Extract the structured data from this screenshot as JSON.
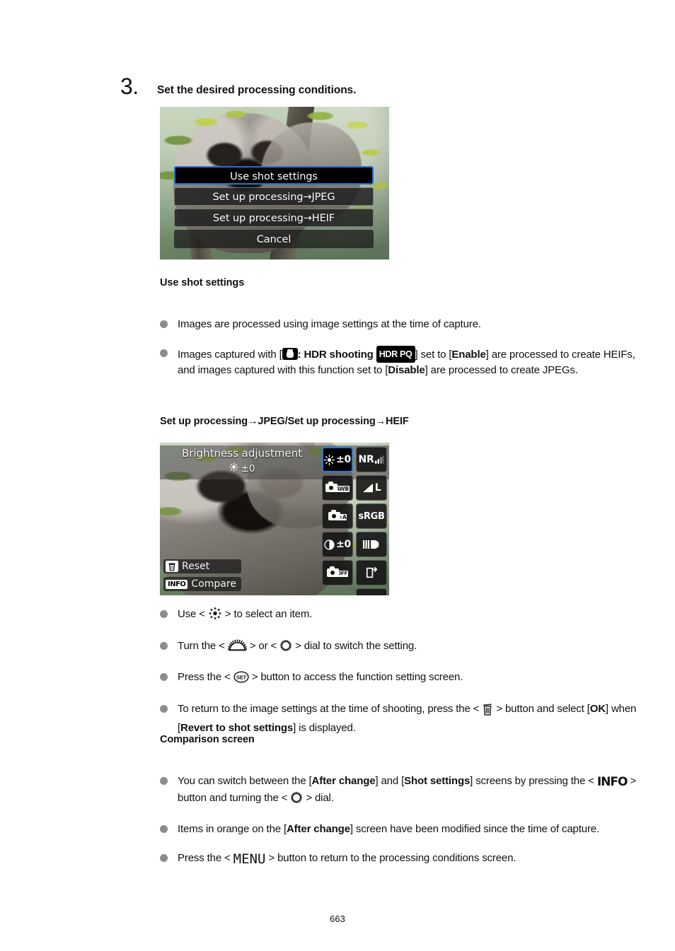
{
  "step": {
    "number": "3.",
    "title": "Set the desired processing conditions."
  },
  "screen1": {
    "name": "processing-conditions-menu",
    "items": [
      {
        "label": "Use shot settings",
        "selected": true
      },
      {
        "label": "Set up processing→JPEG",
        "selected": false
      },
      {
        "label": "Set up processing→HEIF",
        "selected": false
      },
      {
        "label": "Cancel",
        "selected": false
      }
    ],
    "highlight_color": "#1f6fe0"
  },
  "section_use_shot": {
    "heading": "Use shot settings",
    "bullets": [
      {
        "parts": [
          {
            "t": "text",
            "v": "Images are processed using image settings at the time of capture."
          }
        ]
      },
      {
        "parts": [
          {
            "t": "text",
            "v": "Images captured with ["
          },
          {
            "t": "icon",
            "v": "camera-icon"
          },
          {
            "t": "bold",
            "v": ": HDR shooting "
          },
          {
            "t": "badge",
            "v": "HDR PQ"
          },
          {
            "t": "text",
            "v": "] set to ["
          },
          {
            "t": "bold",
            "v": "Enable"
          },
          {
            "t": "text",
            "v": "] are processed to create HEIFs, and images captured with this function set to ["
          },
          {
            "t": "bold",
            "v": "Disable"
          },
          {
            "t": "text",
            "v": "] are processed to create JPEGs."
          }
        ]
      }
    ]
  },
  "section_setup": {
    "heading": "Set up processing→JPEG/Set up processing→HEIF"
  },
  "screen2": {
    "name": "quick-control-processing-screen",
    "title": "Brightness adjustment",
    "value": "±0",
    "value_icon": "brightness-sun-icon",
    "magnify_icon": "magnify-icon",
    "highlight_color": "#1f7ae0",
    "grid": [
      {
        "id": "brightness-adjustment",
        "label": "±0",
        "icon": "sun-icon",
        "selected": true
      },
      {
        "id": "noise-reduction",
        "label": "NR",
        "icon": "nr-bars-icon",
        "selected": false
      },
      {
        "id": "white-balance",
        "label": "AWB",
        "icon": "camera-awb-icon",
        "selected": false
      },
      {
        "id": "image-quality",
        "label": "L",
        "icon": "quality-fine-large-icon",
        "selected": false
      },
      {
        "id": "picture-style",
        "label": "A",
        "icon": "camera-picture-style-auto-icon",
        "selected": false
      },
      {
        "id": "color-space",
        "label": "sRGB",
        "icon": "srgb-icon",
        "selected": false
      },
      {
        "id": "contrast",
        "label": "±0",
        "icon": "contrast-icon",
        "selected": false
      },
      {
        "id": "lens-aberration-correction",
        "label": "",
        "icon": "lens-correction-icon",
        "selected": false
      },
      {
        "id": "dust-delete-data",
        "label": "OFF",
        "icon": "camera-off-icon",
        "selected": false
      },
      {
        "id": "save-image",
        "label": "",
        "icon": "save-icon",
        "selected": false
      },
      {
        "id": "blank",
        "label": "",
        "icon": "",
        "selected": false
      },
      {
        "id": "return",
        "label": "",
        "icon": "return-arrow-icon",
        "selected": false
      }
    ],
    "reset_label": "Reset",
    "reset_icon": "trash-icon",
    "compare_label": "Compare",
    "compare_icon": "info-chip-icon"
  },
  "section_setup_bullets": {
    "bullets": [
      {
        "parts": [
          {
            "t": "text",
            "v": "Use < "
          },
          {
            "t": "icon",
            "v": "multi-controller-icon"
          },
          {
            "t": "text",
            "v": " > to select an item."
          }
        ]
      },
      {
        "parts": [
          {
            "t": "text",
            "v": "Turn the < "
          },
          {
            "t": "icon",
            "v": "main-dial-icon"
          },
          {
            "t": "text",
            "v": " > or < "
          },
          {
            "t": "icon",
            "v": "quick-control-dial-icon"
          },
          {
            "t": "text",
            "v": " > dial to switch the setting."
          }
        ]
      },
      {
        "parts": [
          {
            "t": "text",
            "v": "Press the < "
          },
          {
            "t": "icon",
            "v": "set-button-icon"
          },
          {
            "t": "text",
            "v": " > button to access the function setting screen."
          }
        ]
      },
      {
        "parts": [
          {
            "t": "text",
            "v": "To return to the image settings at the time of shooting, press the < "
          },
          {
            "t": "icon",
            "v": "trash-icon"
          },
          {
            "t": "text",
            "v": " > button and select ["
          },
          {
            "t": "bold",
            "v": "OK"
          },
          {
            "t": "text",
            "v": "] when ["
          },
          {
            "t": "bold",
            "v": "Revert to shot settings"
          },
          {
            "t": "text",
            "v": "] is displayed."
          }
        ]
      }
    ]
  },
  "section_comparison": {
    "heading": "Comparison screen",
    "bullets": [
      {
        "parts": [
          {
            "t": "text",
            "v": "You can switch between the ["
          },
          {
            "t": "bold",
            "v": "After change"
          },
          {
            "t": "text",
            "v": "] and ["
          },
          {
            "t": "bold",
            "v": "Shot settings"
          },
          {
            "t": "text",
            "v": "] screens by pressing the < "
          },
          {
            "t": "icon",
            "v": "info-button-icon"
          },
          {
            "t": "text",
            "v": " > button and turning the < "
          },
          {
            "t": "icon",
            "v": "quick-control-dial-icon"
          },
          {
            "t": "text",
            "v": " > dial."
          }
        ]
      },
      {
        "parts": [
          {
            "t": "text",
            "v": "Items in orange on the ["
          },
          {
            "t": "bold",
            "v": "After change"
          },
          {
            "t": "text",
            "v": "] screen have been modified since the time of capture."
          }
        ]
      },
      {
        "parts": [
          {
            "t": "text",
            "v": "Press the < "
          },
          {
            "t": "icon",
            "v": "menu-button-icon"
          },
          {
            "t": "text",
            "v": " > button to return to the processing conditions screen."
          }
        ]
      }
    ]
  },
  "page_number": "663"
}
